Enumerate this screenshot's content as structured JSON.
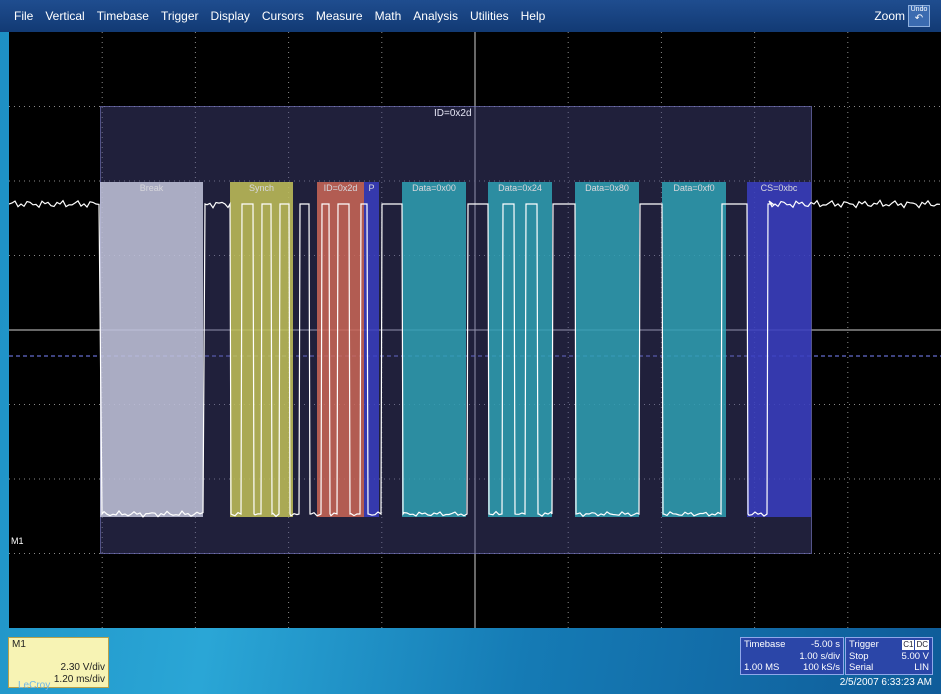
{
  "menu": {
    "items": [
      "File",
      "Vertical",
      "Timebase",
      "Trigger",
      "Display",
      "Cursors",
      "Measure",
      "Math",
      "Analysis",
      "Utilities",
      "Help"
    ],
    "zoom_label": "Zoom",
    "undo_label": "Undo"
  },
  "decode": {
    "frame_label": "ID=0x2d",
    "segments": [
      {
        "label": "Break",
        "color": "#c9cbe2"
      },
      {
        "label": "Synch",
        "color": "#c9c85a"
      },
      {
        "label": "ID=0x2d",
        "color": "#d26a58"
      },
      {
        "label": "P",
        "color": "#3a3fc6"
      },
      {
        "label": "Data=0x00",
        "color": "#2fa5b8"
      },
      {
        "label": "Data=0x24",
        "color": "#2fa5b8"
      },
      {
        "label": "Data=0x80",
        "color": "#2fa5b8"
      },
      {
        "label": "Data=0xf0",
        "color": "#2fa5b8"
      },
      {
        "label": "CS=0xbc",
        "color": "#3a3fc6"
      }
    ]
  },
  "trace": {
    "label": "M1",
    "color": "#ffffff"
  },
  "m1_panel": {
    "title": "M1",
    "vdiv": "2.30 V/div",
    "tdiv": "1.20 ms/div"
  },
  "timebase": {
    "title": "Timebase",
    "offset": "-5.00 s",
    "rate": "1.00 s/div",
    "samples": "1.00 MS",
    "sample_rate": "100 kS/s"
  },
  "trigger": {
    "title": "Trigger",
    "chips": [
      "C1",
      "DC"
    ],
    "mode": "Stop",
    "level": "5.00 V",
    "type": "Serial",
    "protocol": "LIN"
  },
  "brand": "LeCroy",
  "datetime": "2/5/2007 6:33:23 AM"
}
